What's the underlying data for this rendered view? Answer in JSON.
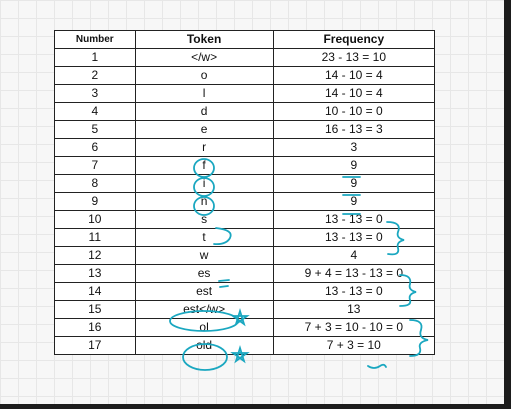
{
  "table": {
    "headers": [
      "Number",
      "Token",
      "Frequency"
    ],
    "rows": [
      [
        "1",
        "</w>",
        "23 - 13 = 10"
      ],
      [
        "2",
        "o",
        "14 - 10 = 4"
      ],
      [
        "3",
        "l",
        "14 - 10 = 4"
      ],
      [
        "4",
        "d",
        "10 - 10 = 0"
      ],
      [
        "5",
        "e",
        "16 - 13 = 3"
      ],
      [
        "6",
        "r",
        "3"
      ],
      [
        "7",
        "f",
        "9"
      ],
      [
        "8",
        "i",
        "9"
      ],
      [
        "9",
        "n",
        "9"
      ],
      [
        "10",
        "s",
        "13 - 13 = 0"
      ],
      [
        "11",
        "t",
        "13 - 13 = 0"
      ],
      [
        "12",
        "w",
        "4"
      ],
      [
        "13",
        "es",
        "9 + 4 = 13 - 13 = 0"
      ],
      [
        "14",
        "est",
        "13 - 13 = 0"
      ],
      [
        "15",
        "est</w>",
        "13"
      ],
      [
        "16",
        "ol",
        "7 + 3 = 10 - 10 = 0"
      ],
      [
        "17",
        "old",
        "7 + 3 = 10"
      ]
    ]
  },
  "colors": {
    "annotation": "#1aa7c0",
    "border": "#222222",
    "grid": "#e7e7e7"
  }
}
